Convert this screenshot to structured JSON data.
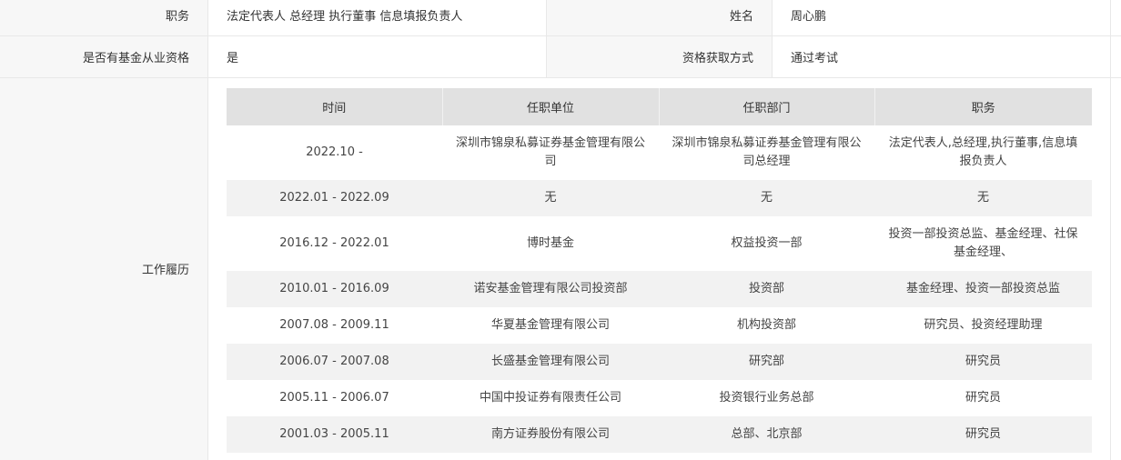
{
  "info": {
    "row1": {
      "label1": "职务",
      "value1": "法定代表人 总经理 执行董事 信息填报负责人",
      "label2": "姓名",
      "value2": "周心鹏"
    },
    "row2": {
      "label1": "是否有基金从业资格",
      "value1": "是",
      "label2": "资格获取方式",
      "value2": "通过考试"
    }
  },
  "history": {
    "label": "工作履历",
    "headers": [
      "时间",
      "任职单位",
      "任职部门",
      "职务"
    ],
    "rows": [
      [
        "2022.10 -",
        "深圳市锦泉私募证券基金管理有限公司",
        "深圳市锦泉私募证券基金管理有限公司总经理",
        "法定代表人,总经理,执行董事,信息填报负责人"
      ],
      [
        "2022.01 - 2022.09",
        "无",
        "无",
        "无"
      ],
      [
        "2016.12 - 2022.01",
        "博时基金",
        "权益投资一部",
        "投资一部投资总监、基金经理、社保基金经理、"
      ],
      [
        "2010.01 - 2016.09",
        "诺安基金管理有限公司投资部",
        "投资部",
        "基金经理、投资一部投资总监"
      ],
      [
        "2007.08 - 2009.11",
        "华夏基金管理有限公司",
        "机构投资部",
        "研究员、投资经理助理"
      ],
      [
        "2006.07 - 2007.08",
        "长盛基金管理有限公司",
        "研究部",
        "研究员"
      ],
      [
        "2005.11 - 2006.07",
        "中国中投证券有限责任公司",
        "投资银行业务总部",
        "研究员"
      ],
      [
        "2001.03 - 2005.11",
        "南方证券股份有限公司",
        "总部、北京部",
        "研究员"
      ]
    ]
  }
}
